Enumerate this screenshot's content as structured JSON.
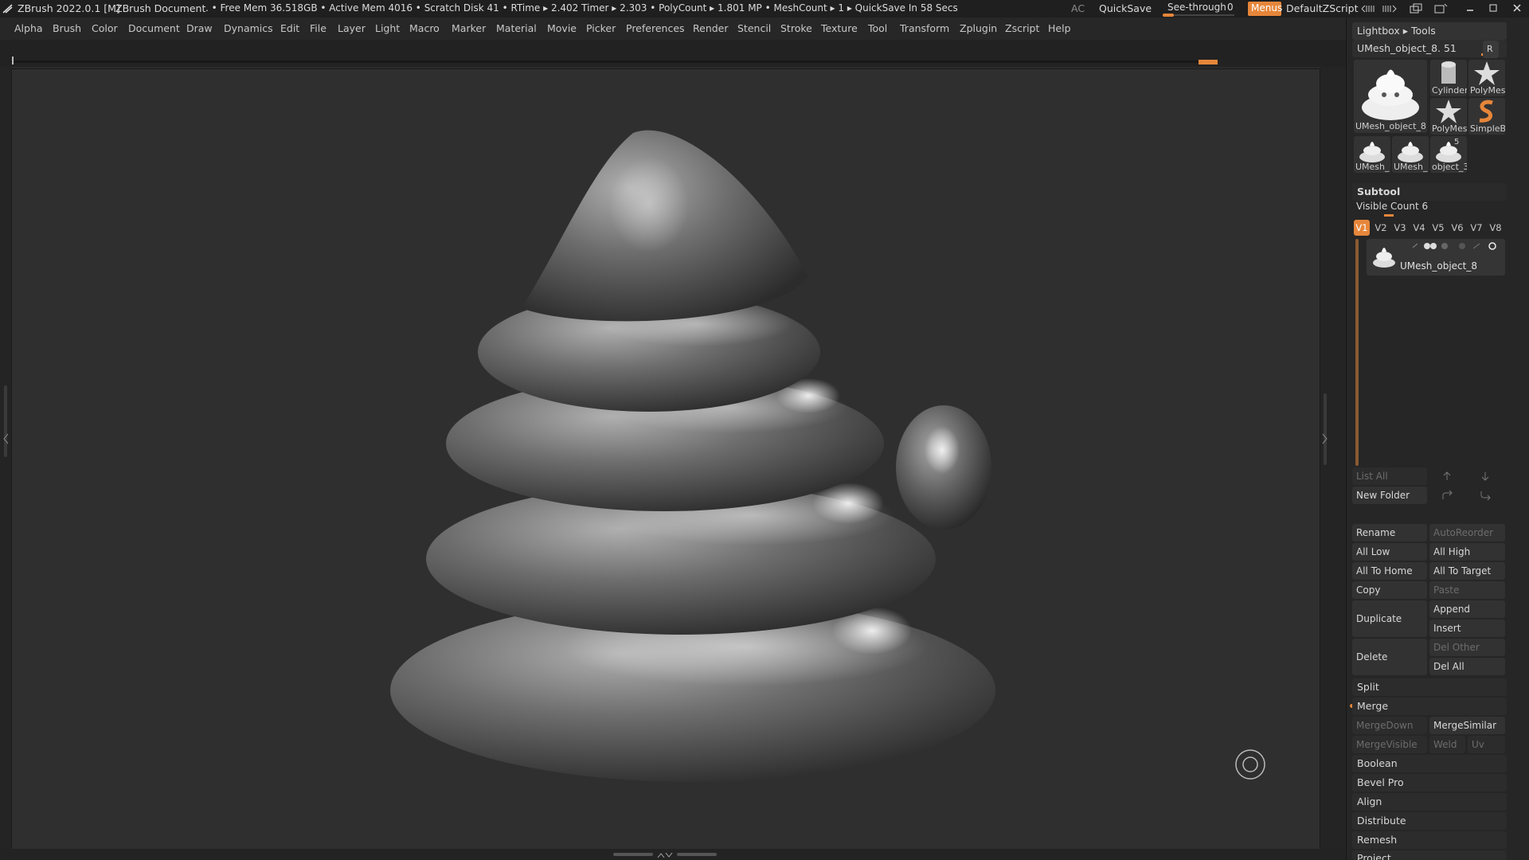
{
  "titlebar": {
    "app": "ZBrush 2022.0.1 [M]",
    "document": "ZBrush Document",
    "stats": ". • Free Mem 36.518GB • Active Mem 4016 • Scratch Disk 41 •  RTime ▸ 2.402 Timer ▸ 2.303 • PolyCount ▸ 1.801 MP  • MeshCount ▸ 1  ▸ QuickSave In 58 Secs",
    "ac": "AC",
    "quicksave": "QuickSave",
    "see_through_label": "See-through",
    "see_through_value": "0",
    "see_through_fill": 0.0,
    "menus": "Menus",
    "default_zscript": "DefaultZScript",
    "accent": "#e6863a"
  },
  "menus": [
    "Alpha",
    "Brush",
    "Color",
    "Document",
    "Draw",
    "Dynamics",
    "Edit",
    "File",
    "Layer",
    "Light",
    "Macro",
    "Marker",
    "Material",
    "Movie",
    "Picker",
    "Preferences",
    "Render",
    "Stencil",
    "Stroke",
    "Texture",
    "Tool",
    "Transform",
    "Zplugin",
    "Zscript",
    "Help"
  ],
  "tool_panel": {
    "header": "Lightbox ▸ Tools",
    "current_tool": "UMesh_object_8. 51",
    "r_button": "R",
    "thumbs": [
      {
        "label": "UMesh_object_8",
        "icon": "blob-icon"
      },
      {
        "label": "Cylinder",
        "icon": "cylinder-icon"
      },
      {
        "label": "PolyMes",
        "icon": "star-icon"
      },
      {
        "label": "PolyMes",
        "icon": "star-icon"
      },
      {
        "label": "SimpleB",
        "icon": "simplebrush-icon"
      },
      {
        "label": "UMesh_",
        "icon": "blob-icon"
      },
      {
        "label": "UMesh_",
        "icon": "blob-icon"
      },
      {
        "label": "object_3",
        "icon": "blob-icon",
        "badge": "5"
      }
    ]
  },
  "subtool": {
    "title": "Subtool",
    "visible_count_label": "Visible Count",
    "visible_count": "6",
    "versions": [
      "V1",
      "V2",
      "V3",
      "V4",
      "V5",
      "V6",
      "V7",
      "V8"
    ],
    "active_version": "V1",
    "item_name": "UMesh_object_8",
    "list_all": "List All",
    "new_folder": "New Folder",
    "rename": "Rename",
    "auto_reorder": "AutoReorder",
    "all_low": "All Low",
    "all_high": "All High",
    "all_to_home": "All To Home",
    "all_to_target": "All To Target",
    "copy": "Copy",
    "paste": "Paste",
    "duplicate": "Duplicate",
    "append": "Append",
    "insert": "Insert",
    "delete": "Delete",
    "del_other": "Del Other",
    "del_all": "Del All",
    "split": "Split",
    "merge": "Merge",
    "merge_down": "MergeDown",
    "merge_similar": "MergeSimilar",
    "merge_visible": "MergeVisible",
    "weld": "Weld",
    "uv": "Uv",
    "boolean": "Boolean",
    "bevel_pro": "Bevel Pro",
    "align": "Align",
    "distribute": "Distribute",
    "remesh": "Remesh",
    "project": "Project"
  }
}
